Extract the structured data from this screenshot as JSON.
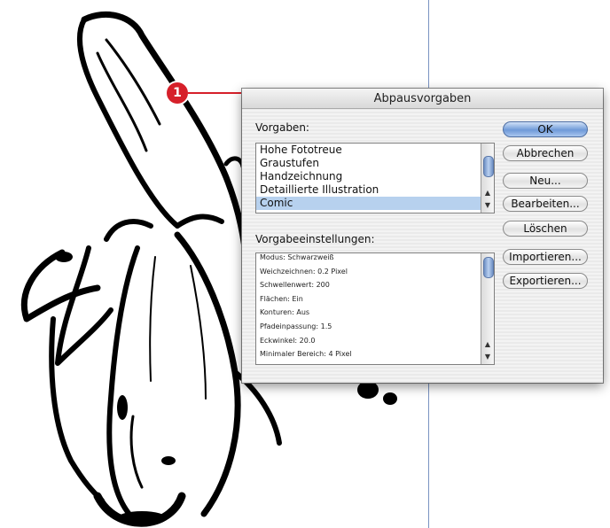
{
  "dialog": {
    "title": "Abpausvorgaben",
    "presets_label": "Vorgaben:",
    "presets": [
      {
        "label": "Hohe Fototreue",
        "selected": false
      },
      {
        "label": "Graustufen",
        "selected": false
      },
      {
        "label": "Handzeichnung",
        "selected": false
      },
      {
        "label": "Detaillierte Illustration",
        "selected": false
      },
      {
        "label": "Comic",
        "selected": true
      }
    ],
    "settings_label": "Vorgabeeinstellungen:",
    "settings": [
      "Modus: Schwarzweiß",
      "Weichzeichnen: 0.2 Pixel",
      "Schwellenwert: 200",
      "Flächen: Ein",
      "Konturen: Aus",
      "Pfadeinpassung: 1.5",
      "Eckwinkel: 20.0",
      "Minimaler Bereich: 4 Pixel"
    ],
    "buttons": {
      "ok": "OK",
      "cancel": "Abbrechen",
      "new": "Neu...",
      "edit": "Bearbeiten...",
      "delete": "Löschen",
      "import": "Importieren...",
      "export": "Exportieren..."
    }
  },
  "callout": {
    "number": "1",
    "color": "#d6202a"
  },
  "colors": {
    "selection": "#b7d1ee",
    "guide": "#7a93c2"
  }
}
